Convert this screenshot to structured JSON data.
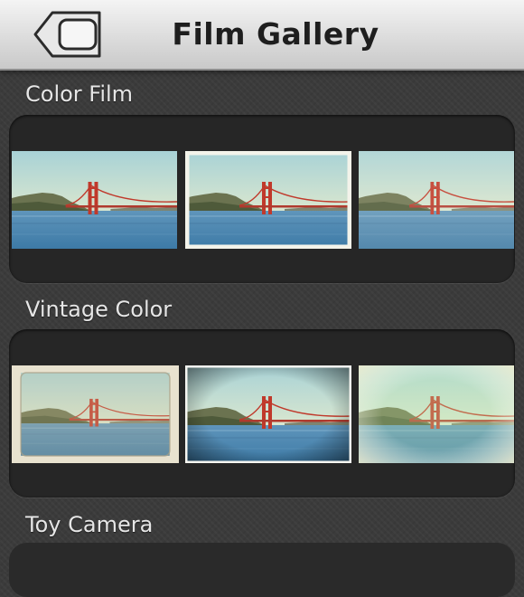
{
  "header": {
    "title": "Film Gallery",
    "back_icon": "back-arrow-icon"
  },
  "sections": [
    {
      "label": "Color Film",
      "thumbnails": [
        {
          "style": "standard"
        },
        {
          "style": "white-border"
        },
        {
          "style": "faded"
        }
      ]
    },
    {
      "label": "Vintage Color",
      "thumbnails": [
        {
          "style": "aged-frame"
        },
        {
          "style": "vignette"
        },
        {
          "style": "cross-processed"
        }
      ]
    },
    {
      "label": "Toy Camera",
      "thumbnails": []
    }
  ],
  "colors": {
    "header_bg": "#dcdcdc",
    "title": "#1e1e1e",
    "panel_bg": "#262626",
    "background": "#3b3b3b",
    "bridge_red": "#c0392b"
  }
}
